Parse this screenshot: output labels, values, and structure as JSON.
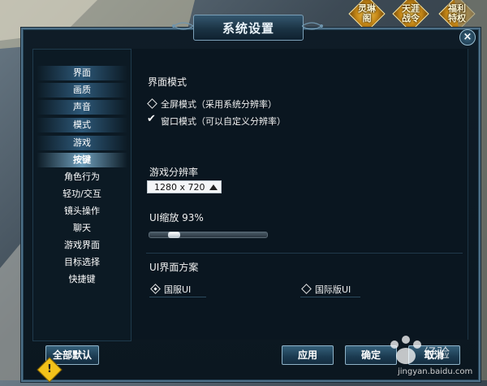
{
  "top_buttons": [
    "灵琳\n阁",
    "天涯\n战令",
    "福利\n特权"
  ],
  "dialog": {
    "title": "系统设置"
  },
  "sidebar": {
    "items": [
      "界面",
      "画质",
      "声音",
      "模式",
      "游戏",
      "按键",
      "角色行为",
      "轻功/交互",
      "镜头操作",
      "聊天",
      "游戏界面",
      "目标选择",
      "快捷键"
    ],
    "active_item": "按键"
  },
  "content": {
    "mode_section": {
      "heading": "界面模式",
      "options": [
        "全屏模式（采用系统分辨率）",
        "窗口模式（可以自定义分辨率）"
      ],
      "selected": "窗口模式（可以自定义分辨率）"
    },
    "resolution": {
      "label": "游戏分辨率",
      "value": "1280 x 720"
    },
    "ui_scale": {
      "label": "UI缩放 93%",
      "level": 0.18
    },
    "ui_scheme": {
      "heading": "UI界面方案",
      "options": [
        "国服UI",
        "国际版UI"
      ],
      "selected": "国服UI"
    }
  },
  "buttons": {
    "reset": "全部默认",
    "apply": "应用",
    "confirm": "确定",
    "cancel": "取消"
  },
  "icons": {
    "close": "close-icon",
    "warning": "warning-icon",
    "watermark": "baidu-watermark"
  },
  "watermark_text": "jingyan.baidu.com"
}
